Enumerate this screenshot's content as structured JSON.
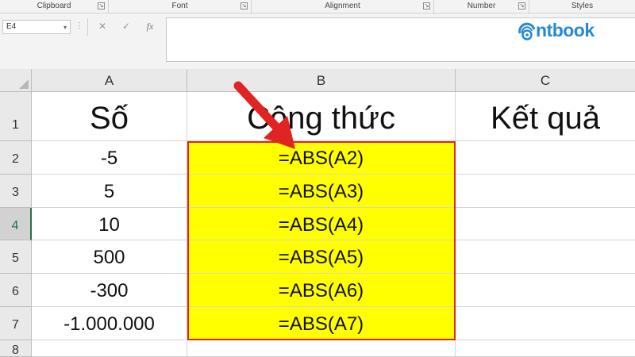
{
  "ribbon": {
    "groups": [
      {
        "label": "Clipboard",
        "launcher": "↘"
      },
      {
        "label": "Font",
        "launcher": "↘"
      },
      {
        "label": "Alignment",
        "launcher": "↘"
      },
      {
        "label": "Number",
        "launcher": "↘"
      },
      {
        "label": "Styles",
        "launcher": ""
      }
    ]
  },
  "formula_bar": {
    "name_box": "E4",
    "name_box_caret": "▾",
    "dots": "⋮",
    "cancel": "✕",
    "enter": "✓",
    "fx": "fx",
    "value": ""
  },
  "logo": {
    "text": "ntbook",
    "color": "#2589d6"
  },
  "columns": [
    "A",
    "B",
    "C"
  ],
  "rows": [
    "1",
    "2",
    "3",
    "4",
    "5",
    "6",
    "7",
    "8"
  ],
  "active_row": "4",
  "header_row": {
    "a": "Số",
    "b": "Công thức",
    "c": "Kết quả"
  },
  "data_rows": [
    {
      "a": "-5",
      "b": "=ABS(A2)",
      "c": ""
    },
    {
      "a": "5",
      "b": "=ABS(A3)",
      "c": ""
    },
    {
      "a": "10",
      "b": "=ABS(A4)",
      "c": ""
    },
    {
      "a": "500",
      "b": "=ABS(A5)",
      "c": ""
    },
    {
      "a": "-300",
      "b": "=ABS(A6)",
      "c": ""
    },
    {
      "a": "-1.000.000",
      "b": "=ABS(A7)",
      "c": ""
    }
  ],
  "colors": {
    "highlight": "#ffff00",
    "selection_border": "#e02424",
    "arrow": "#e02424",
    "active_row_text": "#217346"
  }
}
